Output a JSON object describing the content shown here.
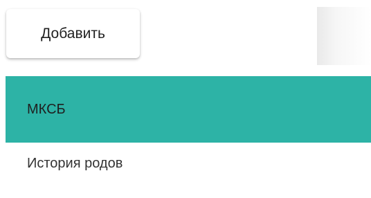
{
  "toolbar": {
    "add_label": "Добавить"
  },
  "menu": {
    "items": [
      {
        "label": "МКСБ",
        "active": true
      },
      {
        "label": "История родов",
        "active": false
      }
    ]
  },
  "colors": {
    "active_item_bg": "#2db3a6",
    "button_bg": "#ffffff",
    "text": "#212121"
  }
}
